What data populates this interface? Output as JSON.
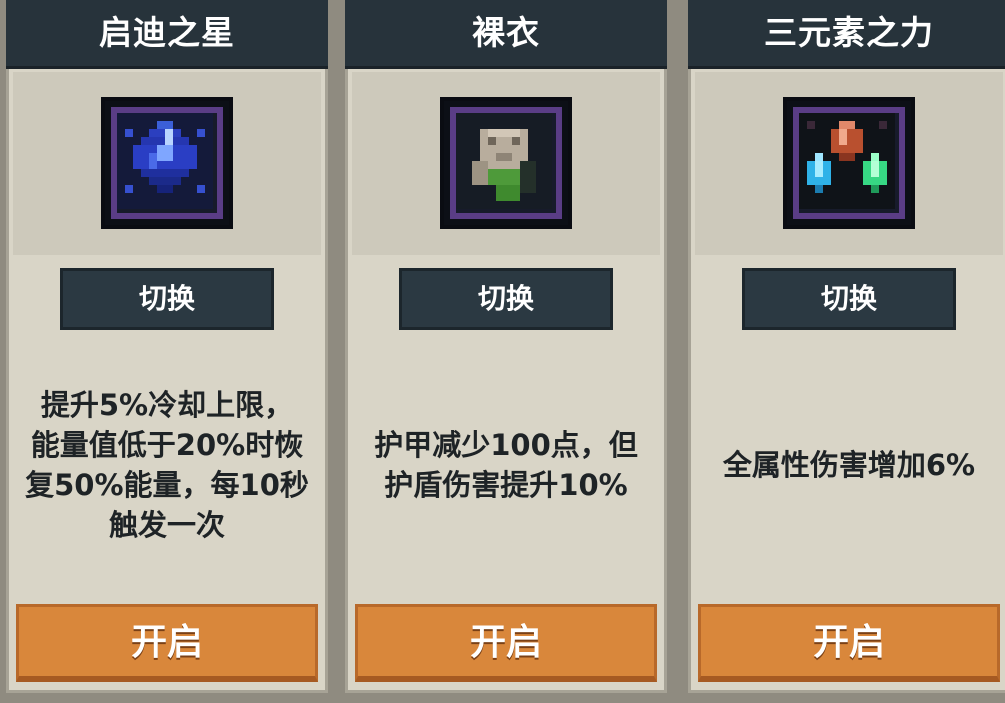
{
  "cards": [
    {
      "title": "启迪之星",
      "icon": "blue-star-crystal-icon",
      "switch_label": "切换",
      "description": "提升5%冷却上限，\n能量值低于20%时恢\n复50%能量，每10秒\n触发一次",
      "open_label": "开启"
    },
    {
      "title": "裸衣",
      "icon": "bare-clothes-figure-icon",
      "switch_label": "切换",
      "description": "护甲减少100点，但\n护盾伤害提升10%",
      "open_label": "开启"
    },
    {
      "title": "三元素之力",
      "icon": "three-elements-crystals-icon",
      "switch_label": "切换",
      "description": "全属性伤害增加6%",
      "open_label": "开启"
    }
  ],
  "colors": {
    "header": "#27333b",
    "card": "#d9d5c7",
    "switch_button": "#2b3942",
    "open_button": "#d9873b",
    "icon_rim": "#5a3d86"
  }
}
